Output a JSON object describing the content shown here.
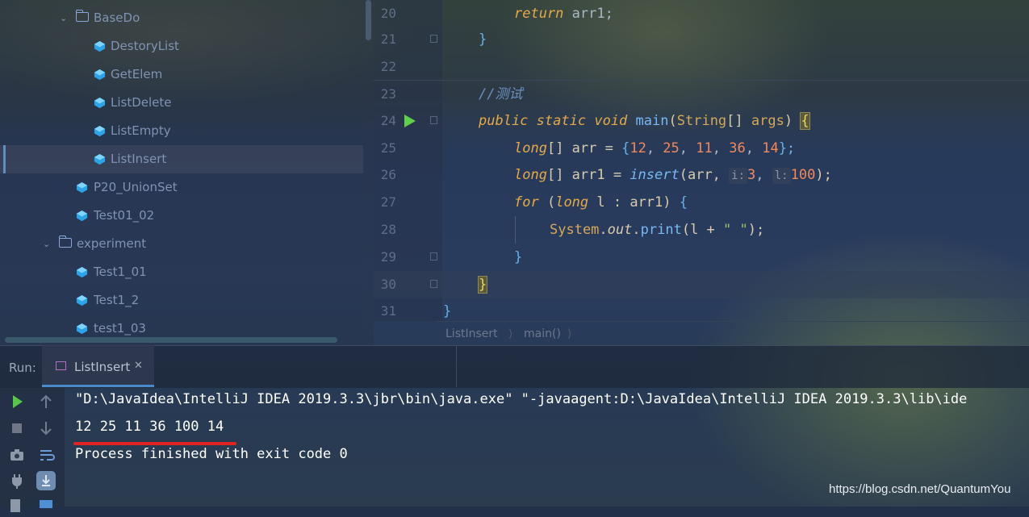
{
  "project_tree": {
    "items": [
      {
        "label": "BaseDo",
        "type": "folder",
        "expanded": true,
        "icon": "folder-icon"
      },
      {
        "label": "DestoryList",
        "type": "class",
        "icon": "java-class-icon"
      },
      {
        "label": "GetElem",
        "type": "class",
        "icon": "java-class-icon"
      },
      {
        "label": "ListDelete",
        "type": "class",
        "icon": "java-class-icon"
      },
      {
        "label": "ListEmpty",
        "type": "class",
        "icon": "java-class-icon"
      },
      {
        "label": "ListInsert",
        "type": "class",
        "icon": "java-class-icon",
        "selected": true
      },
      {
        "label": "P20_UnionSet",
        "type": "class",
        "icon": "java-class-icon"
      },
      {
        "label": "Test01_02",
        "type": "class",
        "icon": "java-class-icon"
      },
      {
        "label": "experiment",
        "type": "folder",
        "expanded": true,
        "icon": "folder-icon"
      },
      {
        "label": "Test1_01",
        "type": "class",
        "icon": "java-class-icon"
      },
      {
        "label": "Test1_2",
        "type": "class",
        "icon": "java-class-icon"
      },
      {
        "label": "test1_03",
        "type": "class",
        "icon": "java-class-icon"
      }
    ]
  },
  "editor": {
    "line_numbers": [
      "20",
      "21",
      "22",
      "23",
      "24",
      "25",
      "26",
      "27",
      "28",
      "29",
      "30",
      "31"
    ],
    "code": {
      "l20": {
        "kw": "return",
        "rest": " arr1;"
      },
      "l21": {
        "brace": "}"
      },
      "l23": {
        "comment": "//测试"
      },
      "l24": {
        "kw1": "public",
        "kw2": "static",
        "kw3": "void",
        "fn": "main",
        "p1": "(",
        "type": "String",
        "p2": "[] ",
        "param": "args",
        "p3": ") ",
        "brace": "{"
      },
      "l25": {
        "type": "long",
        "p1": "[] arr = ",
        "brace": "{",
        "n1": "12",
        "c1": ", ",
        "n2": "25",
        "c2": ", ",
        "n3": "11",
        "c3": ", ",
        "n4": "36",
        "c4": ", ",
        "n5": "14",
        "end": "};"
      },
      "l26": {
        "type": "long",
        "p1": "[] arr1 = ",
        "fn": "insert",
        "p2": "(arr, ",
        "hint1": "i:",
        "n1": "3",
        "c1": ", ",
        "hint2": "l:",
        "n2": "100",
        "end": ");"
      },
      "l27": {
        "kw": "for",
        "p1": " (",
        "type": "long",
        "p2": " l : arr1) ",
        "brace": "{"
      },
      "l28": {
        "cls": "System",
        "dot1": ".",
        "field": "out",
        "dot2": ".",
        "fn": "print",
        "p1": "(l + ",
        "str": "\" \"",
        "end": ");"
      },
      "l29": {
        "brace": "}"
      },
      "l30": {
        "brace": "}"
      },
      "l31": {
        "brace": "}"
      }
    },
    "breadcrumb": [
      "ListInsert",
      "main()"
    ]
  },
  "run_window": {
    "title": "Run:",
    "tab_label": "ListInsert",
    "tab_close": "✕",
    "console": [
      "\"D:\\JavaIdea\\IntelliJ IDEA 2019.3.3\\jbr\\bin\\java.exe\" \"-javaagent:D:\\JavaIdea\\IntelliJ IDEA 2019.3.3\\lib\\ide",
      "12 25 11 36 100 14",
      "Process finished with exit code 0"
    ],
    "toolbar_icons": [
      "rerun-icon",
      "stop-icon",
      "camera-icon",
      "plug-icon",
      "up-arrow-icon",
      "down-arrow-icon",
      "soft-wrap-icon",
      "scroll-to-end-icon"
    ]
  },
  "watermark": "https://blog.csdn.net/QuantumYou",
  "colors": {
    "keyword": "#e5a94a",
    "function": "#79b8f2",
    "number": "#f08a5e",
    "string": "#8fc66a",
    "comment": "#6a8fbd",
    "run_arrow": "#5ed04a",
    "underline": "#e02424"
  }
}
